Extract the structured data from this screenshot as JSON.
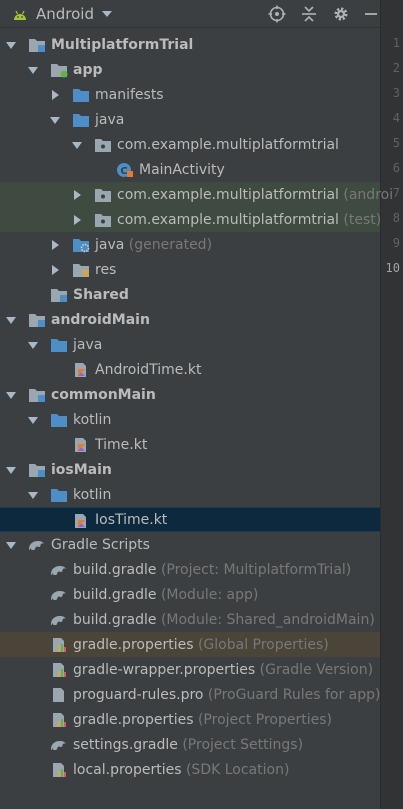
{
  "toolbar": {
    "view_title": "Android",
    "icons": [
      "android-icon",
      "locate-icon",
      "collapse-all-icon",
      "settings-gear-icon",
      "hide-icon"
    ]
  },
  "gutter": {
    "lines": [
      "1",
      "2",
      "3",
      "4",
      "5",
      "6",
      "7",
      "8",
      "9",
      "10"
    ]
  },
  "tree": [
    {
      "name": "MultiplatformTrial",
      "hint": "",
      "bold": true
    },
    {
      "name": "app",
      "hint": "",
      "bold": true
    },
    {
      "name": "manifests",
      "hint": ""
    },
    {
      "name": "java",
      "hint": ""
    },
    {
      "name": "com.example.multiplatformtrial",
      "hint": ""
    },
    {
      "name": "MainActivity",
      "hint": ""
    },
    {
      "name": "com.example.multiplatformtrial",
      "hint": " (androi"
    },
    {
      "name": "com.example.multiplatformtrial",
      "hint": " (test)"
    },
    {
      "name": "java",
      "hint": " (generated)"
    },
    {
      "name": "res",
      "hint": ""
    },
    {
      "name": "Shared",
      "hint": "",
      "bold": true
    },
    {
      "name": "androidMain",
      "hint": "",
      "bold": true
    },
    {
      "name": "java",
      "hint": ""
    },
    {
      "name": "AndroidTime.kt",
      "hint": ""
    },
    {
      "name": "commonMain",
      "hint": "",
      "bold": true
    },
    {
      "name": "kotlin",
      "hint": ""
    },
    {
      "name": "Time.kt",
      "hint": ""
    },
    {
      "name": "iosMain",
      "hint": "",
      "bold": true
    },
    {
      "name": "kotlin",
      "hint": ""
    },
    {
      "name": "IosTime.kt",
      "hint": ""
    },
    {
      "name": "Gradle Scripts",
      "hint": ""
    },
    {
      "name": "build.gradle",
      "hint": " (Project: MultiplatformTrial)"
    },
    {
      "name": "build.gradle",
      "hint": " (Module: app)"
    },
    {
      "name": "build.gradle",
      "hint": " (Module: Shared_androidMain)"
    },
    {
      "name": "gradle.properties",
      "hint": " (Global Properties)"
    },
    {
      "name": "gradle-wrapper.properties",
      "hint": " (Gradle Version)"
    },
    {
      "name": "proguard-rules.pro",
      "hint": " (ProGuard Rules for app)"
    },
    {
      "name": "gradle.properties",
      "hint": " (Project Properties)"
    },
    {
      "name": "settings.gradle",
      "hint": " (Project Settings)"
    },
    {
      "name": "local.properties",
      "hint": " (SDK Location)"
    }
  ],
  "colors": {
    "background": "#3c3f41",
    "selection": "#0d293e",
    "highlight": "#3f4a41",
    "warning_row": "#4a4538",
    "folder_blue": "#4c8ec5",
    "module_gray": "#9aa7b0",
    "hint_gray": "#787878"
  }
}
